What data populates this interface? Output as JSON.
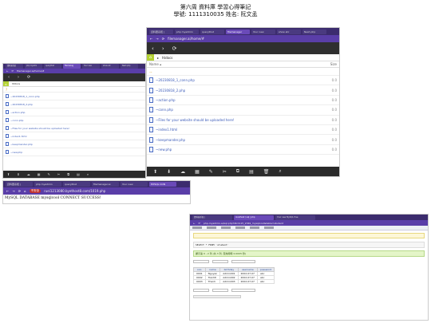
{
  "doc": {
    "title": "第六周 資料庫 學習心得筆記",
    "subtitle": "學號: 1111310035 姓名: 阮文孟"
  },
  "fm_large": {
    "tabs": [
      "資料庫系統 |",
      "php myadmin",
      "queryPost",
      "filemanager",
      "Your new",
      "show etc",
      "Nesh php"
    ],
    "url": "filemanager.ai/home/#",
    "breadcrumb": "htdocs",
    "col_name": "Name ▴",
    "col_size": "Size",
    "parent": "..",
    "files": [
      {
        "name": "~20230818_1_conn.php",
        "size": "0.0"
      },
      {
        "name": "~20230818_2.php",
        "size": "0.0"
      },
      {
        "name": "~action.php",
        "size": "0.0"
      },
      {
        "name": "~conn.php",
        "size": "0.0"
      },
      {
        "name": "~Files for your website should be uploaded here!",
        "size": "0.0"
      },
      {
        "name": "~index1.html",
        "size": "0.0"
      },
      {
        "name": "~keepmander.php",
        "size": "0.0"
      },
      {
        "name": "~new.php",
        "size": "0.0"
      }
    ]
  },
  "fm_small": {
    "tabs": [
      "資料庫系統",
      "php myadm",
      "queryPost",
      "filemanag",
      "Your new",
      "show etc",
      "Nesh php"
    ],
    "url": "filemanager.ai/home/#",
    "breadcrumb": "htdocs",
    "files": [
      "~20230818_1_conn.php",
      "~20230818_2.php",
      "~action.php",
      "~conn.php",
      "~Files for your website should be uploaded here!",
      "~index1.html",
      "~keepmander.php",
      "~new.php"
    ]
  },
  "browser_msg": {
    "tabs": [
      "資料庫系統 |",
      "php myadmin",
      "queryPost",
      "filemanager.ai",
      "Your new",
      "MYSQL CON"
    ],
    "url_badge": "不安全",
    "url": "ruei1213080.byethost8.com/1019.php",
    "message": "MySQL DATABASE mysqlcool CONNECT SUCCESS!"
  },
  "pma": {
    "tabs": [
      "資料庫系統 |",
      "localhost / sql | php",
      "Your new MySQL free"
    ],
    "url": "php-myadmin.ai/sql.php?db=b15_2349_mysqlcool&table=student",
    "status_line": "顯示第 0 - 2 列 (共 3 列, 查詢用時 0.0005 秒)",
    "sql": "SELECT * FROM `student`",
    "table_headers": [
      "sno",
      "name",
      "birthday",
      "username",
      "password"
    ],
    "rows": [
      [
        "0001",
        "Nguyen",
        "Admin001",
        "2002-07-07",
        "abc"
      ],
      [
        "0002",
        "Tranhtl",
        "Admin002",
        "2002-07-07",
        "abc"
      ],
      [
        "0003",
        "Thanh",
        "Admin003",
        "2002-07-07",
        "abc"
      ]
    ]
  }
}
